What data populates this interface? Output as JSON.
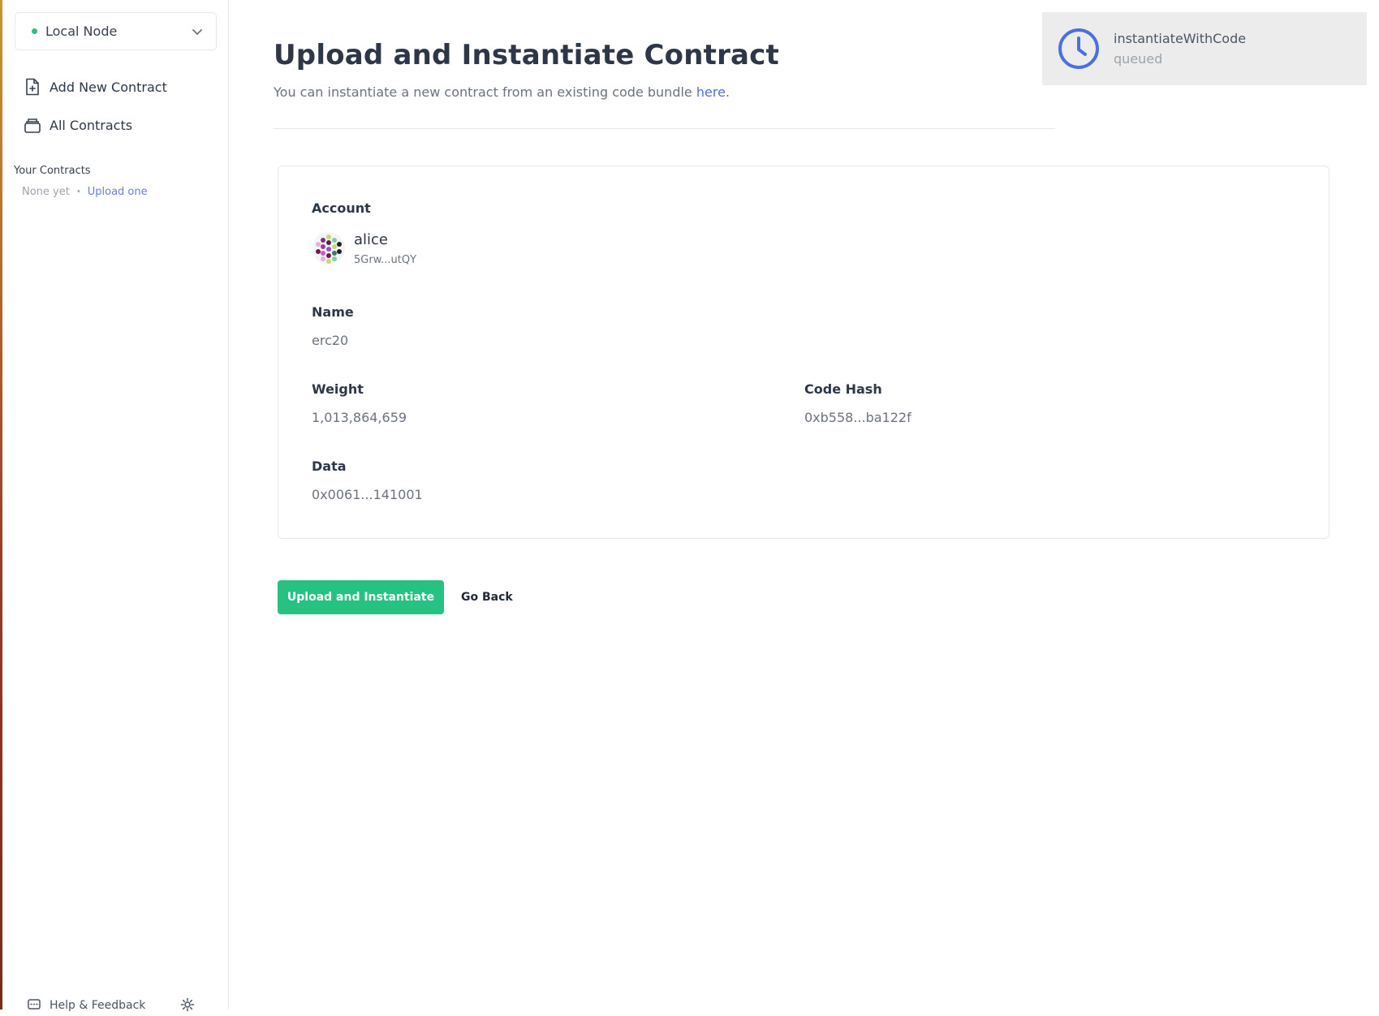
{
  "sidebar": {
    "node": {
      "label": "Local Node",
      "status_color": "#26c281"
    },
    "nav": [
      {
        "label": "Add New Contract",
        "icon": "file-plus-icon"
      },
      {
        "label": "All Contracts",
        "icon": "stack-icon"
      }
    ],
    "your_contracts": {
      "title": "Your Contracts",
      "empty_text": "None yet",
      "separator": "•",
      "upload_link": "Upload one"
    },
    "footer": {
      "help_label": "Help & Feedback"
    }
  },
  "header": {
    "title": "Upload and Instantiate Contract",
    "subtitle_prefix": "You can instantiate a new contract from an existing code bundle ",
    "subtitle_link": "here",
    "subtitle_suffix": "."
  },
  "summary": {
    "account": {
      "label": "Account",
      "name": "alice",
      "address": "5Grw...utQY"
    },
    "name": {
      "label": "Name",
      "value": "erc20"
    },
    "weight": {
      "label": "Weight",
      "value": "1,013,864,659"
    },
    "code_hash": {
      "label": "Code Hash",
      "value": "0xb558...ba122f"
    },
    "data": {
      "label": "Data",
      "value": "0x0061...141001"
    }
  },
  "actions": {
    "primary": "Upload and Instantiate",
    "secondary": "Go Back"
  },
  "toast": {
    "title": "instantiateWithCode",
    "status": "queued",
    "icon": "clock-icon",
    "accent": "#4a6fe0"
  },
  "colors": {
    "primary": "#26c281",
    "link": "#4f6fd8"
  }
}
